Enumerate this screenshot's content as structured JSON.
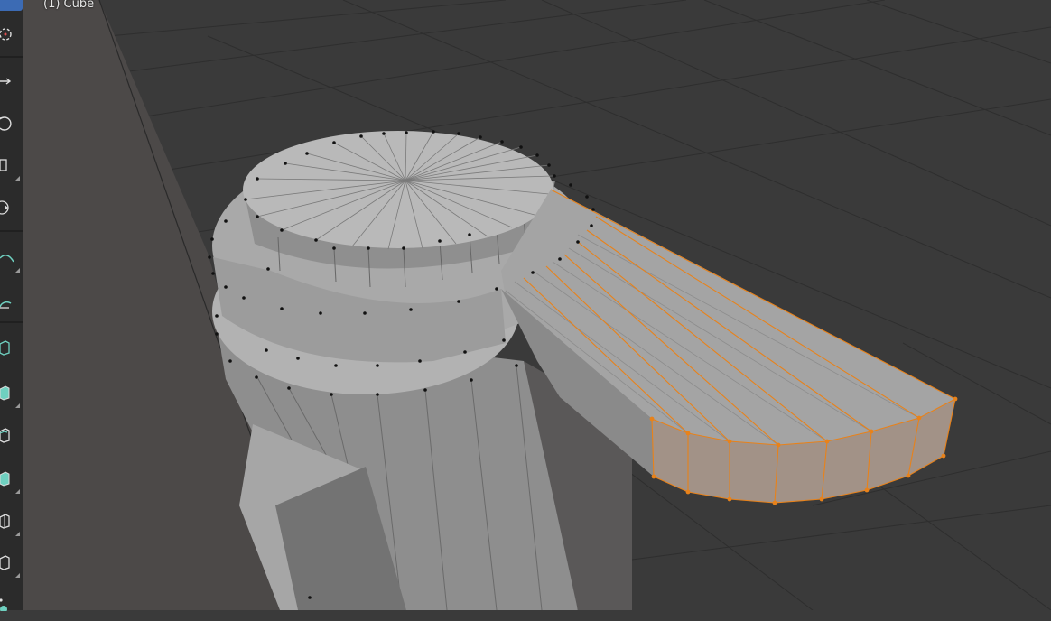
{
  "viewport": {
    "object_label": "(1) Cube",
    "background_color": "#3a3a3a",
    "grid_color": "#2f2f2f",
    "mesh_color": "#a8a8a8",
    "selection_color": "#e8821a"
  },
  "toolbar": {
    "tools": [
      {
        "name": "cursor-tool",
        "icon": "cursor-icon"
      },
      {
        "name": "move-tool",
        "icon": "move-icon"
      },
      {
        "name": "rotate-tool",
        "icon": "rotate-icon"
      },
      {
        "name": "scale-tool",
        "icon": "scale-icon"
      },
      {
        "name": "transform-tool",
        "icon": "transform-icon"
      },
      {
        "name": "annotate-tool",
        "icon": "annotate-icon"
      },
      {
        "name": "measure-tool",
        "icon": "measure-icon"
      },
      {
        "name": "add-cube-tool",
        "icon": "add-cube-icon"
      },
      {
        "name": "extrude-tool",
        "icon": "extrude-icon"
      },
      {
        "name": "inset-tool",
        "icon": "inset-icon"
      },
      {
        "name": "bevel-tool",
        "icon": "bevel-icon"
      },
      {
        "name": "loop-cut-tool",
        "icon": "loop-cut-icon"
      },
      {
        "name": "knife-tool",
        "icon": "knife-icon"
      },
      {
        "name": "poly-build-tool",
        "icon": "poly-build-icon"
      }
    ]
  }
}
